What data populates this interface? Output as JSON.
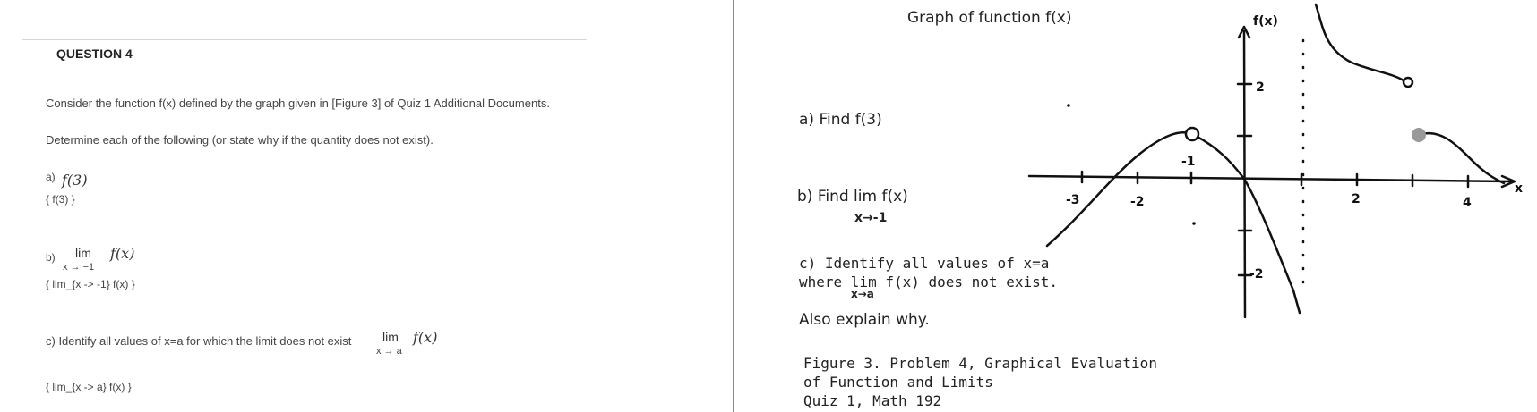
{
  "question": {
    "title": "QUESTION 4",
    "intro": "Consider the function f(x) defined by the graph given in [Figure 3] of Quiz 1 Additional Documents.",
    "instruction": "Determine each of the following (or state why if the quantity does not exist).",
    "part_a": {
      "label": "a)",
      "expr": "f(3)",
      "answer": "{   f(3)   }"
    },
    "part_b": {
      "label": "b)",
      "lim": "lim",
      "expr": "f(x)",
      "sub": "x → −1",
      "answer": "{   lim_{x -> -1} f(x)    }"
    },
    "part_c": {
      "text": "c) Identify all values of x=a for which the limit does not exist",
      "lim": "lim",
      "expr": "f(x)",
      "sub": "x → a",
      "answer": "{   lim_{x -> a} f(x)    }"
    }
  },
  "figure": {
    "heading": "Graph of function f(x)",
    "a": "a) Find f(3)",
    "b_line1": "b) Find  lim  f(x)",
    "b_sub": "x→-1",
    "c_line1": "c) Identify all values of x=a",
    "c_line2": "where lim  f(x) does not exist.",
    "c_sub": "x→a",
    "also": "Also explain why.",
    "caption1": "Figure 3.  Problem 4, Graphical Evaluation",
    "caption2": "of Function and Limits",
    "caption3": "Quiz 1, Math 192",
    "graph": {
      "y_axis_label": "f(x)",
      "x_axis_label": "x",
      "x_tick_labels": [
        "-3",
        "-2",
        "-1",
        "2",
        "4"
      ],
      "y_tick_labels": [
        "2",
        "-2"
      ]
    }
  }
}
